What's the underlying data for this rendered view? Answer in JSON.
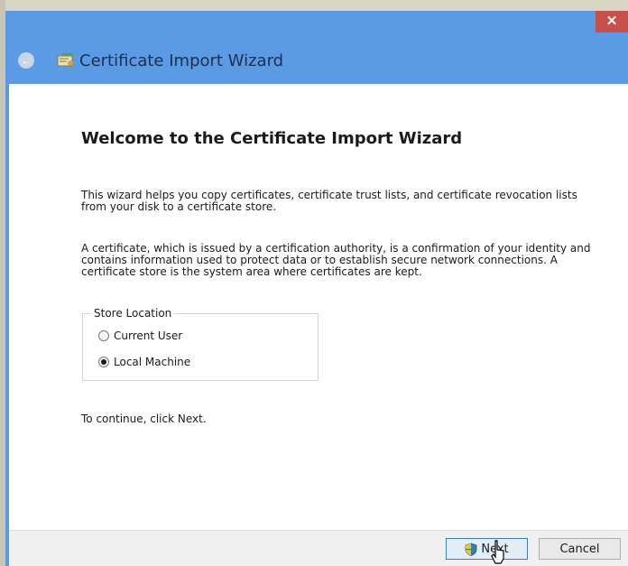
{
  "window": {
    "title": "Certificate Import Wizard",
    "close_glyph": "✕",
    "back_glyph": "←",
    "accent": "#5b9be6"
  },
  "wizard": {
    "heading": "Welcome to the Certificate Import Wizard",
    "paragraph1": "This wizard helps you copy certificates, certificate trust lists, and certificate revocation lists from your disk to a certificate store.",
    "paragraph2": "A certificate, which is issued by a certification authority, is a confirmation of your identity and contains information used to protect data or to establish secure network connections. A certificate store is the system area where certificates are kept.",
    "store_location": {
      "legend": "Store Location",
      "options": [
        {
          "label": "Current User",
          "selected": false
        },
        {
          "label": "Local Machine",
          "selected": true
        }
      ]
    },
    "continue_text": "To continue, click Next."
  },
  "footer": {
    "next_label": "Next",
    "cancel_label": "Cancel"
  },
  "icons": {
    "app": "certificate-icon",
    "next": "uac-shield-icon",
    "cursor": "mouse-cursor-icon"
  }
}
